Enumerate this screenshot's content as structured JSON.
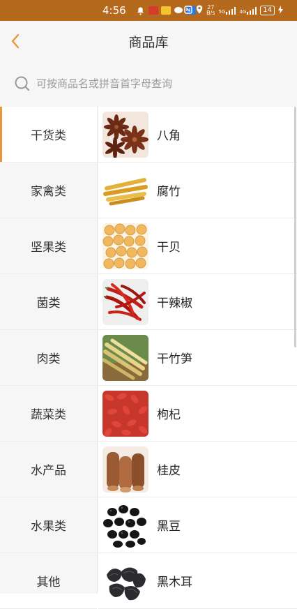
{
  "status_bar": {
    "time": "4:56",
    "speed_value": "27",
    "speed_unit": "B/s",
    "signal1": "5G",
    "signal2": "4G",
    "battery": "14"
  },
  "header": {
    "title": "商品库"
  },
  "search": {
    "placeholder": "可按商品名或拼音首字母查询"
  },
  "categories": [
    {
      "label": "干货类",
      "active": true
    },
    {
      "label": "家禽类"
    },
    {
      "label": "坚果类"
    },
    {
      "label": "菌类"
    },
    {
      "label": "肉类"
    },
    {
      "label": "蔬菜类"
    },
    {
      "label": "水产品"
    },
    {
      "label": "水果类"
    },
    {
      "label": "其他"
    }
  ],
  "products": [
    {
      "name": "八角",
      "image": "star-anise"
    },
    {
      "name": "腐竹",
      "image": "tofu-skin-sticks"
    },
    {
      "name": "干贝",
      "image": "dried-scallops"
    },
    {
      "name": "干辣椒",
      "image": "dried-chili"
    },
    {
      "name": "干竹笋",
      "image": "dried-bamboo-shoots"
    },
    {
      "name": "枸杞",
      "image": "goji-berries"
    },
    {
      "name": "桂皮",
      "image": "cinnamon-bark"
    },
    {
      "name": "黑豆",
      "image": "black-beans"
    },
    {
      "name": "黑木耳",
      "image": "black-fungus"
    }
  ],
  "colors": {
    "status_bar": "#b4691c",
    "accent": "#e8973a",
    "background": "#f6f6f6"
  }
}
